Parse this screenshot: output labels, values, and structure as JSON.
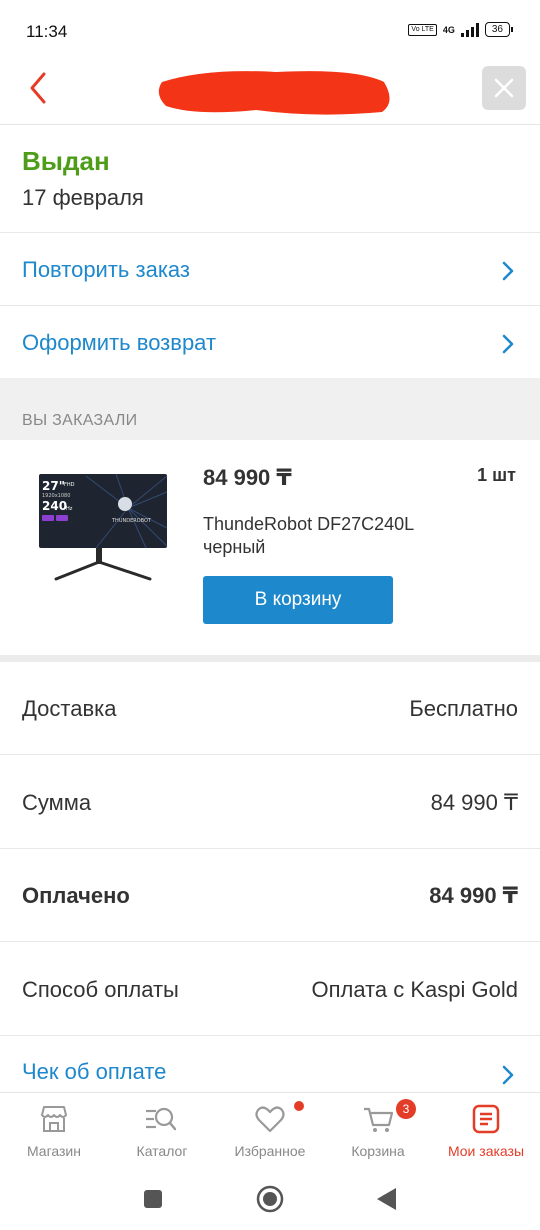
{
  "status_bar": {
    "time": "11:34",
    "network": "4G",
    "volte": "Vo LTE",
    "battery": "36"
  },
  "header": {
    "title": "",
    "back_icon": "back-arrow-icon",
    "close_icon": "close-icon"
  },
  "order": {
    "status": "Выдан",
    "date": "17 февраля",
    "status_color": "#4d9d18"
  },
  "actions": [
    {
      "label": "Повторить заказ"
    },
    {
      "label": "Оформить возврат"
    }
  ],
  "ordered_section": {
    "title": "ВЫ ЗАКАЗАЛИ"
  },
  "product": {
    "price": "84 990 ₸",
    "quantity": "1 шт",
    "name": "ThundeRobot DF27C240L черный",
    "add_to_cart": "В корзину",
    "image_text": {
      "size": "27\"",
      "fhd": "FHD",
      "res": "1920x1080",
      "hz": "240",
      "hz_unit": "Hz",
      "brand": "THUNDEROBOT"
    }
  },
  "summary": {
    "delivery_label": "Доставка",
    "delivery_value": "Бесплатно",
    "sum_label": "Сумма",
    "sum_value": "84 990 ₸",
    "paid_label": "Оплачено",
    "paid_value": "84 990 ₸",
    "payment_method_label": "Способ оплаты",
    "payment_method_value": "Оплата с Kaspi Gold",
    "receipt_label": "Чек об оплате"
  },
  "bottom_nav": [
    {
      "label": "Магазин",
      "icon": "shop-icon"
    },
    {
      "label": "Каталог",
      "icon": "catalog-search-icon"
    },
    {
      "label": "Избранное",
      "icon": "heart-icon"
    },
    {
      "label": "Корзина",
      "icon": "cart-icon",
      "badge": "3"
    },
    {
      "label": "Мои заказы",
      "icon": "orders-icon",
      "active": true
    }
  ],
  "colors": {
    "accent_blue": "#1e88cc",
    "accent_red": "#e33d28",
    "success_green": "#4d9d18"
  }
}
